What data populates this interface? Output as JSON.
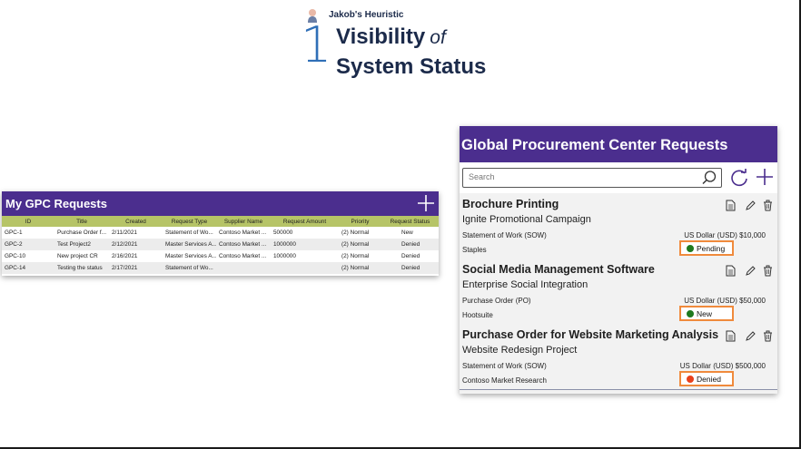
{
  "heading": {
    "eyebrow": "Jakob's Heuristic",
    "number": "1",
    "title_part1": "Visibility",
    "title_of": "of",
    "title_line2": "System Status"
  },
  "gpc_panel": {
    "title": "My GPC Requests",
    "columns": [
      "ID",
      "Title",
      "Created",
      "Request Type",
      "Supplier Name",
      "Request Amount",
      "Priority",
      "Request Status"
    ],
    "rows": [
      [
        "GPC-1",
        "Purchase Order f...",
        "2/11/2021",
        "Statement of Wo...",
        "Contoso Market ...",
        "500000",
        "(2) Normal",
        "New"
      ],
      [
        "GPC-2",
        "Test Project2",
        "2/12/2021",
        "Master Services A...",
        "Contoso Market ...",
        "1000000",
        "(2) Normal",
        "Denied"
      ],
      [
        "GPC-10",
        "New project CR",
        "2/16/2021",
        "Master Services A...",
        "Contoso Market ...",
        "1000000",
        "(2) Normal",
        "Denied"
      ],
      [
        "GPC-14",
        "Testing the status",
        "2/17/2021",
        "Statement of Wo...",
        "",
        "",
        "(2) Normal",
        "Denied"
      ]
    ],
    "colors": {
      "header": "#4b2e8e",
      "column_header": "#b6c467"
    }
  },
  "proc_panel": {
    "title": "Global Procurement Center Requests",
    "search_placeholder": "Search",
    "cards": [
      {
        "title": "Brochure Printing",
        "subtitle": "Ignite Promotional Campaign",
        "type": "Statement of Work (SOW)",
        "amount": "US Dollar (USD) $10,000",
        "vendor": "Staples",
        "status": "Pending",
        "status_color": "#1f7a1f"
      },
      {
        "title": "Social Media Management Software",
        "subtitle": "Enterprise Social Integration",
        "type": "Purchase Order (PO)",
        "amount": "US Dollar (USD) $50,000",
        "vendor": "Hootsuite",
        "status": "New",
        "status_color": "#1f7a1f"
      },
      {
        "title": "Purchase Order for Website Marketing Analysis",
        "subtitle": "Website Redesign Project",
        "type": "Statement of Work (SOW)",
        "amount": "US Dollar (USD) $500,000",
        "vendor": "Contoso Market Research",
        "status": "Denied",
        "status_color": "#e8401c"
      }
    ],
    "colors": {
      "header": "#4b2e8e",
      "status_highlight": "#f08a3c"
    },
    "icons": [
      "search-icon",
      "refresh-icon",
      "add-icon",
      "document-icon",
      "edit-icon",
      "delete-icon"
    ]
  }
}
